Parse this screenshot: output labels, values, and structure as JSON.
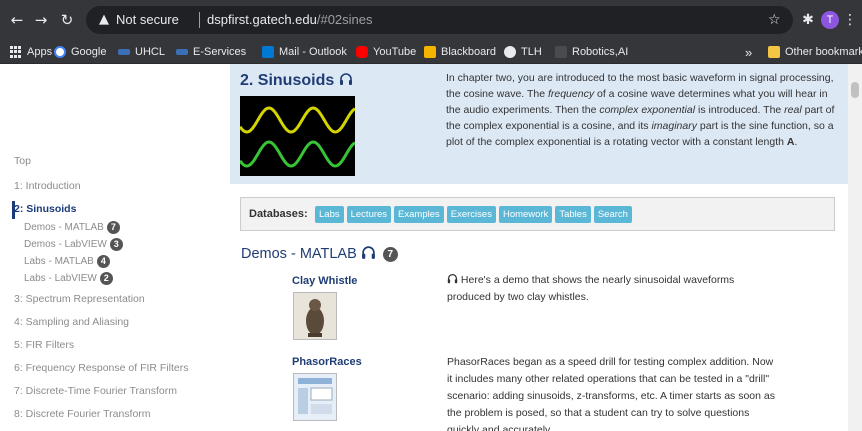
{
  "browser": {
    "url_security": "Not secure",
    "url_host": "dspfirst.gatech.edu",
    "url_path": "/#02sines",
    "avatar_letter": "T",
    "icons": {
      "back": "back-arrow-icon",
      "forward": "forward-arrow-icon",
      "reload": "reload-icon",
      "warning": "warning-icon",
      "star": "star-icon",
      "extensions": "puzzle-icon",
      "menu": "kebab-menu-icon"
    }
  },
  "bookmarks": {
    "items": [
      {
        "label": "Apps",
        "color": "#e8eaed"
      },
      {
        "label": "Google",
        "color": "#4285f4"
      },
      {
        "label": "UHCL",
        "color": "#3b6fb6"
      },
      {
        "label": "E-Services",
        "color": "#3b6fb6"
      },
      {
        "label": "Mail - Outlook",
        "color": "#0078d4"
      },
      {
        "label": "YouTube",
        "color": "#ff0000"
      },
      {
        "label": "Blackboard",
        "color": "#f4b400"
      },
      {
        "label": "TLH",
        "color": "#e8eaed"
      },
      {
        "label": "Robotics,AI",
        "color": "#5f6368"
      }
    ],
    "overflow": "»",
    "other": "Other bookmarks"
  },
  "sidebar": {
    "top": "Top",
    "items": [
      {
        "label": "1: Introduction"
      },
      {
        "label": "2: Sinusoids"
      },
      {
        "label": "3: Spectrum Representation"
      },
      {
        "label": "4: Sampling and Aliasing"
      },
      {
        "label": "5: FIR Filters"
      },
      {
        "label": "6: Frequency Response of FIR Filters"
      },
      {
        "label": "7: Discrete-Time Fourier Transform"
      },
      {
        "label": "8: Discrete Fourier Transform"
      }
    ],
    "subitems": [
      {
        "label": "Demos - MATLAB",
        "count": "7"
      },
      {
        "label": "Demos - LabVIEW",
        "count": "3"
      },
      {
        "label": "Labs - MATLAB",
        "count": "4"
      },
      {
        "label": "Labs - LabVIEW",
        "count": "2"
      }
    ]
  },
  "chapter": {
    "title": "2. Sinusoids",
    "text_parts": [
      "In chapter two, you are introduced to the most basic waveform in signal processing, the cosine wave. The ",
      "frequency",
      " of a cosine wave determines what you will hear in the audio experiments. Then the ",
      "complex exponential",
      " is introduced. The ",
      "real",
      " part of the complex exponential is a cosine, and its ",
      "imaginary",
      " part is the sine function, so a plot of the complex exponential is a rotating vector with a constant length ",
      "A",
      "."
    ],
    "wave_colors": [
      "#d4d400",
      "#39c436"
    ]
  },
  "databases": {
    "label": "Databases:",
    "buttons": [
      "Labs",
      "Lectures",
      "Examples",
      "Exercises",
      "Homework",
      "Tables",
      "Search"
    ]
  },
  "section": {
    "title": "Demos - MATLAB",
    "count": "7",
    "demos": [
      {
        "title": "Clay Whistle",
        "desc": "Here's a demo that shows the nearly sinusoidal waveforms produced by two clay whistles."
      },
      {
        "title": "PhasorRaces",
        "desc": "PhasorRaces began as a speed drill for testing complex addition. Now it includes many other related operations that can be tested in a \"drill\" scenario: adding sinusoids, z-transforms, etc. A timer starts as soon as the problem is posed, so that a student can try to solve questions quickly and accurately."
      }
    ]
  }
}
